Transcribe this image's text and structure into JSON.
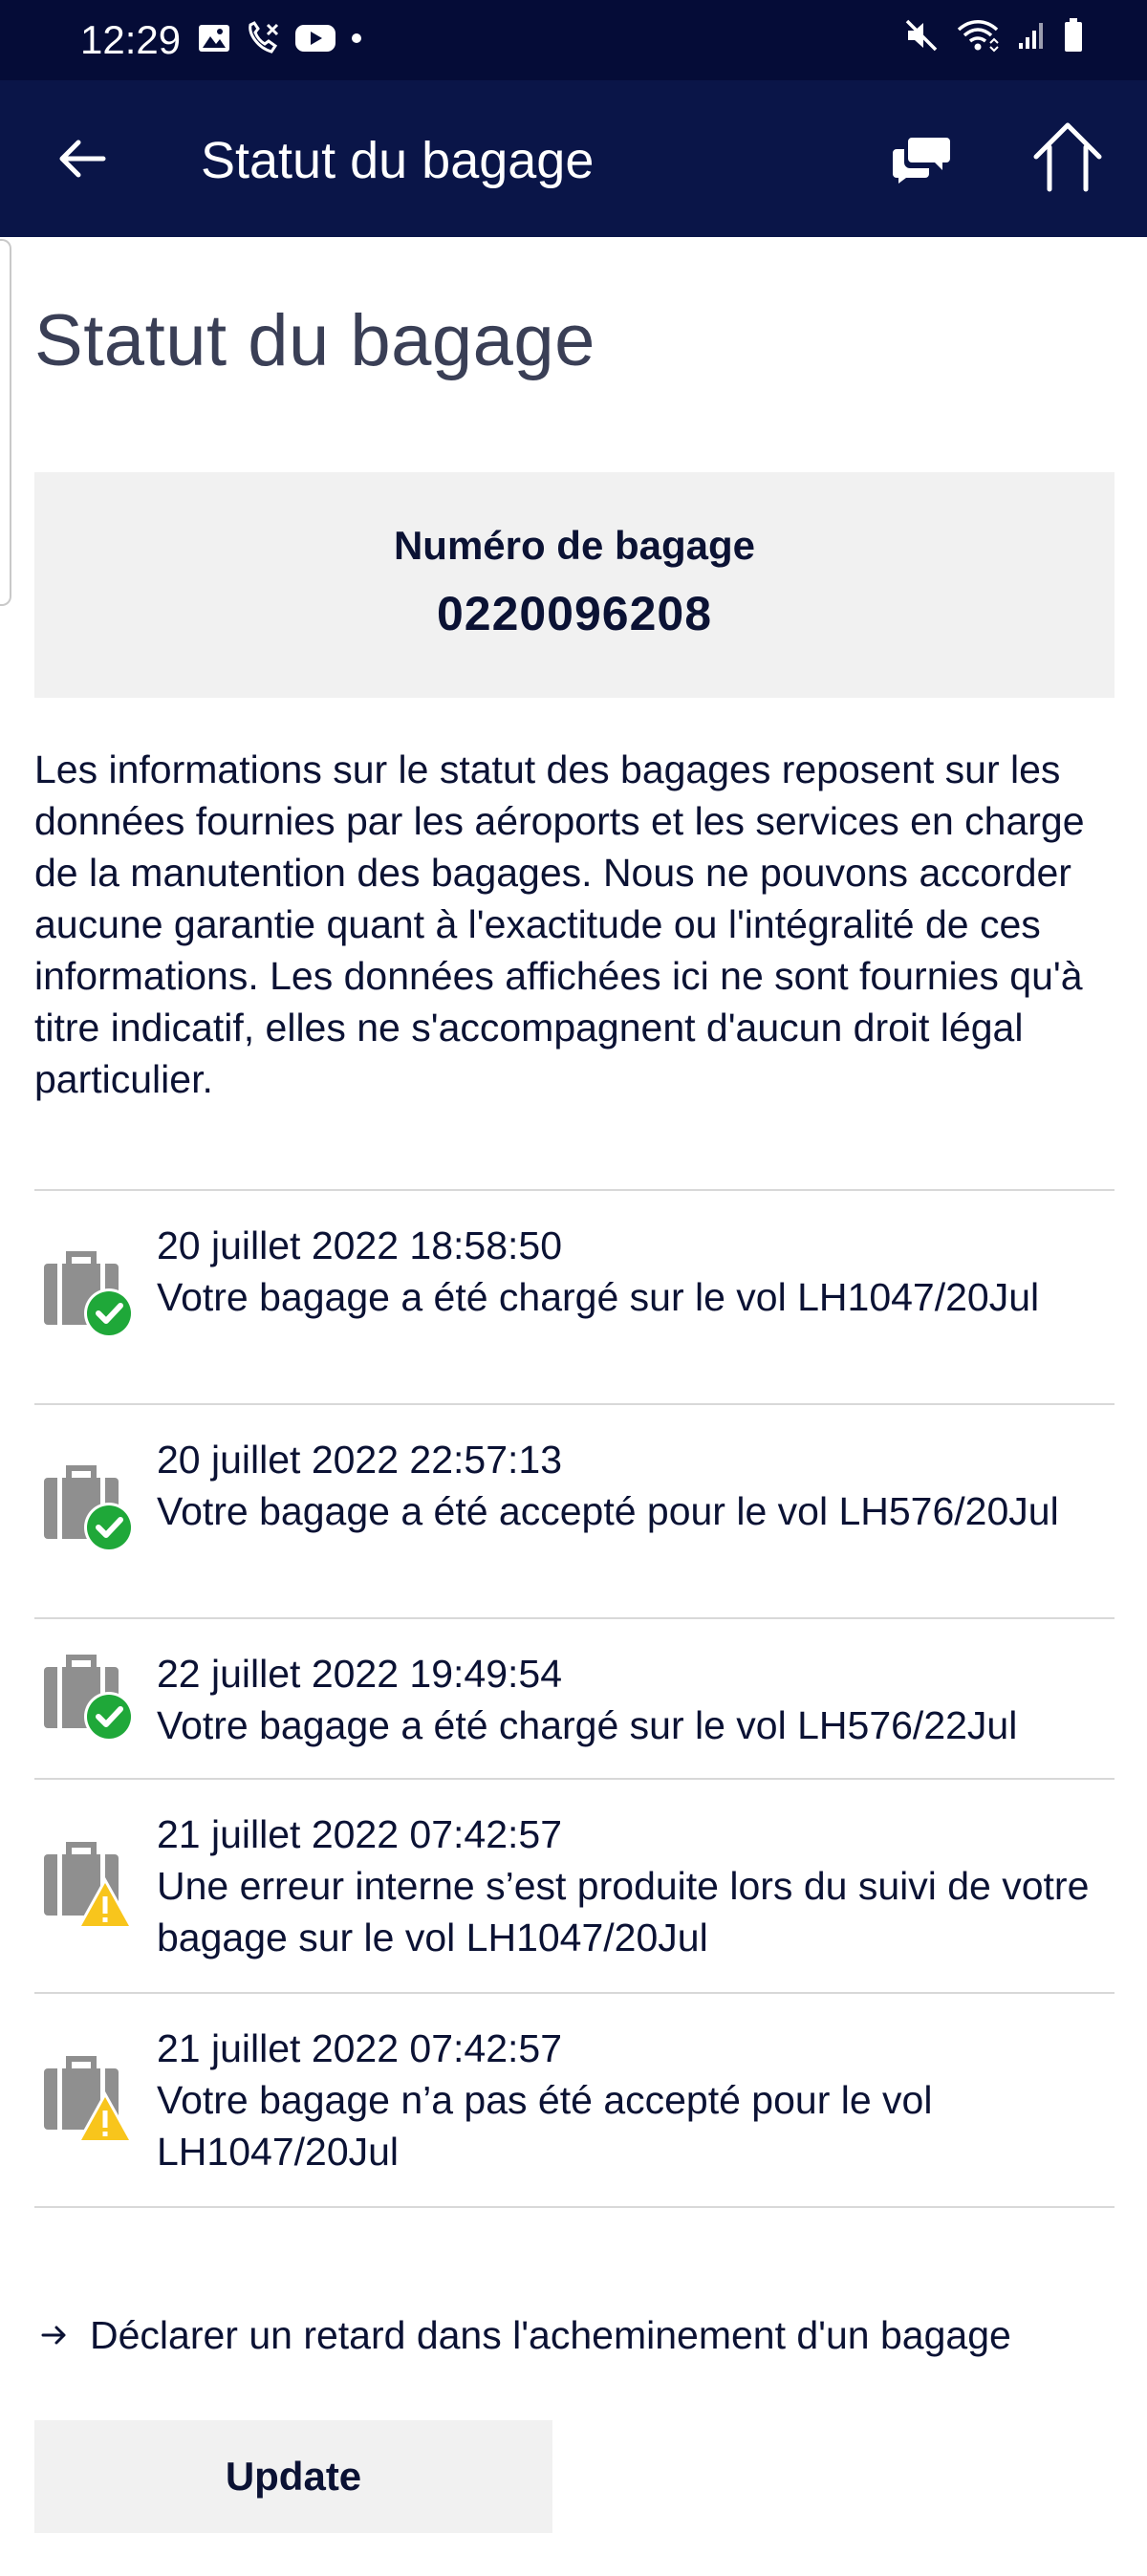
{
  "status_bar": {
    "time": "12:29",
    "left_icons": [
      "image-icon",
      "call-missed-icon",
      "youtube-icon",
      "dot-icon"
    ],
    "right_icons": [
      "mute-icon",
      "wifi-icon",
      "signal-icon",
      "battery-icon"
    ]
  },
  "app_bar": {
    "title": "Statut du bagage",
    "icons": [
      "back-arrow-icon",
      "chat-icon",
      "home-icon"
    ]
  },
  "page": {
    "title": "Statut du bagage",
    "baggage": {
      "label": "Numéro de bagage",
      "number": "0220096208"
    },
    "disclaimer": "Les informations sur le statut des bagages reposent sur les données fournies par les aéroports et les services en charge de la manutention des bagages. Nous ne pouvons accorder aucune garantie quant à l'exactitude ou l'intégralité de ces informations. Les données affichées ici ne sont fournies qu'à titre indicatif, elles ne s'accompagnent d'aucun droit légal particulier.",
    "events": [
      {
        "status": "ok",
        "date": "20 juillet 2022 18:58:50",
        "message": "Votre bagage a été chargé sur le vol LH1047/20Jul"
      },
      {
        "status": "ok",
        "date": "20 juillet 2022 22:57:13",
        "message": "Votre bagage a été accepté pour le vol LH576/20Jul"
      },
      {
        "status": "ok",
        "date": "22 juillet 2022 19:49:54",
        "message": "Votre bagage a été chargé sur le vol LH576/22Jul"
      },
      {
        "status": "warning",
        "date": "21 juillet 2022 07:42:57",
        "message": "Une erreur interne s’est produite lors du suivi de votre bagage sur le vol LH1047/20Jul"
      },
      {
        "status": "warning",
        "date": "21 juillet 2022 07:42:57",
        "message": "Votre bagage n’a pas été accepté pour le vol LH1047/20Jul"
      }
    ],
    "delay_link": "Déclarer un retard dans l'acheminement d'un bagage",
    "update_label": "Update"
  },
  "colors": {
    "status_bar_bg": "#050c37",
    "app_bar_bg": "#0a1548",
    "text": "#0b1234",
    "ok_green": "#1fa839",
    "warning_yellow": "#f8c51c",
    "suitcase_gray": "#8f8f8f"
  }
}
